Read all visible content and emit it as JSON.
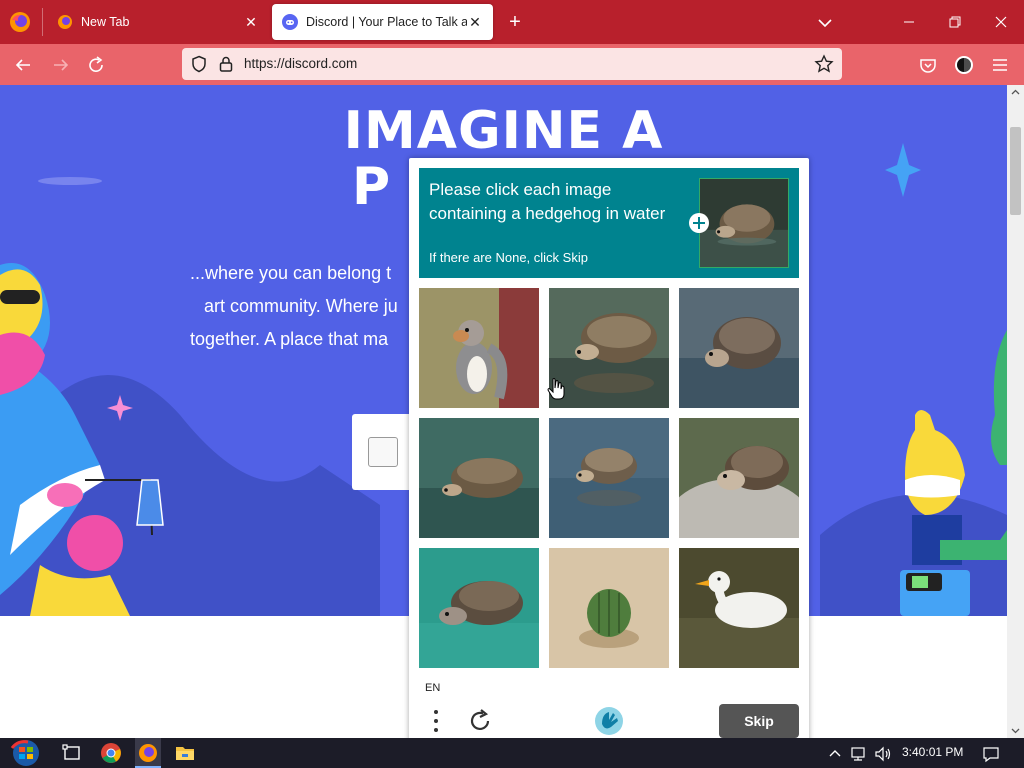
{
  "browser": {
    "tabs": [
      {
        "label": "New Tab",
        "active": false
      },
      {
        "label": "Discord | Your Place to Talk and",
        "active": true
      }
    ],
    "url": "https://discord.com",
    "colors": {
      "tabbar": "#b8202c",
      "navbar": "#e9646a",
      "urlbar": "#fbe4e4"
    }
  },
  "page": {
    "hero_title_line1": "IMAGINE A",
    "hero_title_line2": "P",
    "hero_lines": [
      "...where you can belong t",
      "art community. Where ju",
      "together. A place that ma"
    ],
    "hero_color": "#5161e6"
  },
  "captcha": {
    "prompt": "Please click each image containing a hedgehog in water",
    "subprompt": "If there are None, click Skip",
    "header_color": "#00838f",
    "tiles": [
      {
        "icon": "squirrel-image"
      },
      {
        "icon": "hedgehog-water-image"
      },
      {
        "icon": "hedgehog-water-image"
      },
      {
        "icon": "hedgehog-water-image"
      },
      {
        "icon": "hedgehog-water-image"
      },
      {
        "icon": "hedgehog-rock-image"
      },
      {
        "icon": "hedgehog-water-image"
      },
      {
        "icon": "cactus-sand-image"
      },
      {
        "icon": "duck-image"
      }
    ],
    "language": "EN",
    "skip_label": "Skip"
  },
  "taskbar": {
    "clock": "3:40:01 PM"
  }
}
